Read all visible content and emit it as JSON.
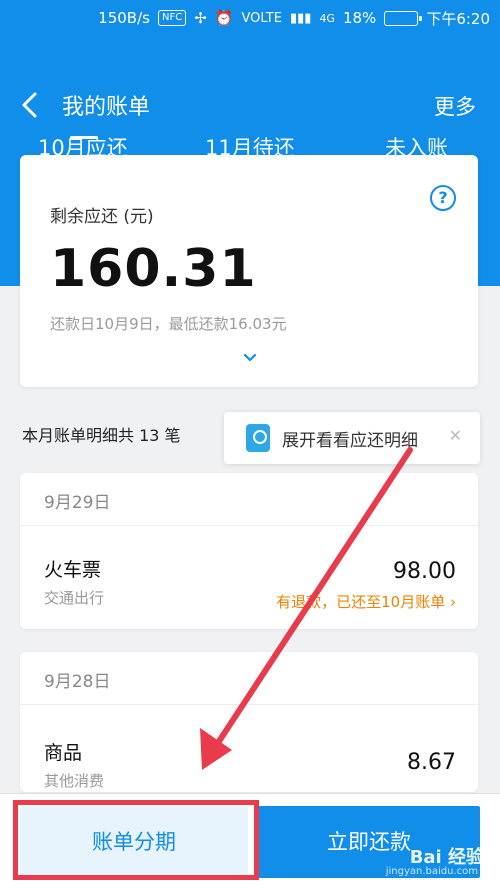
{
  "status_bar": {
    "speed": "150B/s",
    "nfc": "NFC",
    "volte": "VOLTE",
    "signal": "4G",
    "battery": "18%",
    "time": "下午6:20"
  },
  "header": {
    "title": "我的账单",
    "more": "更多",
    "tabs": [
      {
        "label": "10月应还"
      },
      {
        "label": "11月待还"
      },
      {
        "label": "未入账"
      }
    ]
  },
  "summary": {
    "label": "剩余应还 (元)",
    "amount": "160.31",
    "due_note": "还款日10月9日，最低还款16.03元"
  },
  "detail": {
    "count_text": "本月账单明细共 13 笔",
    "tooltip_text": "展开看看应还明细",
    "groups": [
      {
        "date": "9月29日",
        "items": [
          {
            "name": "火车票",
            "category": "交通出行",
            "amount": "98.00",
            "note": "有退款，已还至10月账单 ›"
          }
        ]
      },
      {
        "date": "9月28日",
        "items": [
          {
            "name": "商品",
            "category": "其他消费",
            "amount": "8.67"
          }
        ]
      }
    ]
  },
  "bottom": {
    "installment_label": "账单分期",
    "pay_label": "立即还款"
  },
  "watermark": {
    "text": "Bai 经验",
    "sub": "jingyan.baidu.com"
  },
  "colors": {
    "primary": "#108ee9",
    "warning": "#f08200",
    "highlight": "#e83b4c"
  }
}
